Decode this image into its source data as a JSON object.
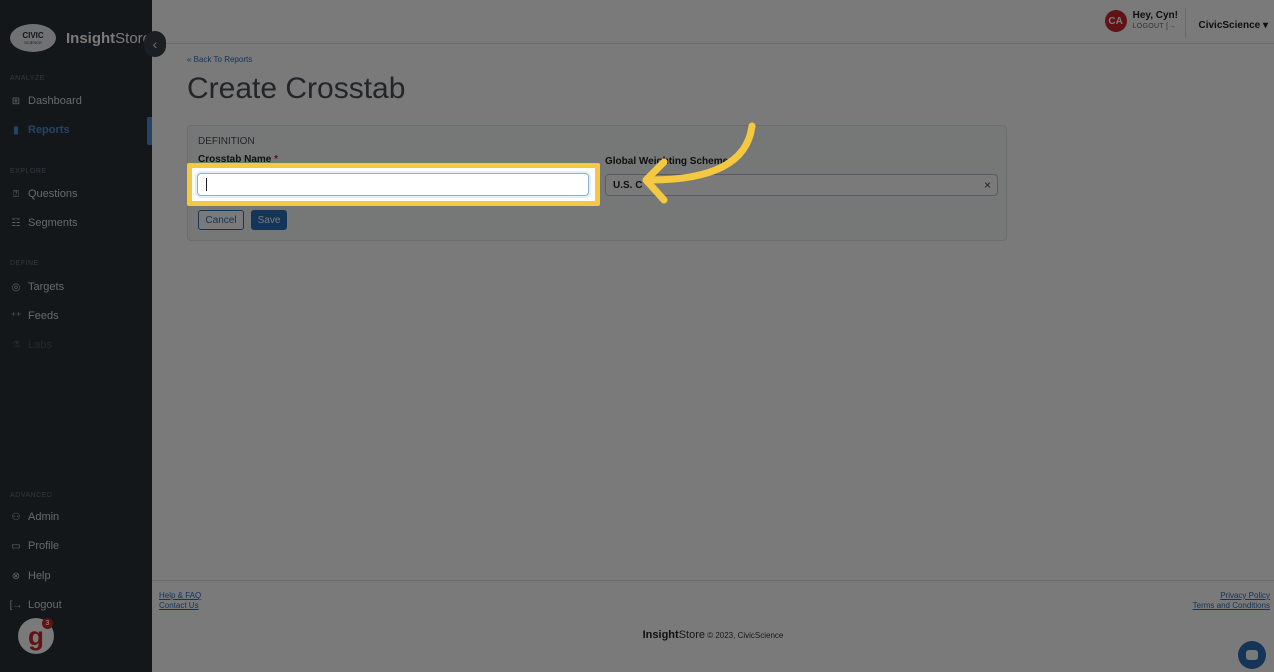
{
  "brand": {
    "logo_top": "CIVIC",
    "logo_bottom": "SCIENCE",
    "name_bold": "Insight",
    "name_rest": "Store"
  },
  "sidebar": {
    "sections": {
      "analyze": "ANALYZE",
      "explore": "EXPLORE",
      "define": "DEFINE",
      "advanced": "ADVANCED"
    },
    "items": {
      "dashboard": "Dashboard",
      "reports": "Reports",
      "questions": "Questions",
      "segments": "Segments",
      "targets": "Targets",
      "feeds": "Feeds",
      "labs": "Labs",
      "admin": "Admin",
      "profile": "Profile",
      "help": "Help",
      "logout": "Logout"
    },
    "collapse_glyph": "‹",
    "badge_letter": "g",
    "badge_sup": "3"
  },
  "topbar": {
    "avatar_initials": "CA",
    "greeting": "Hey, Cyn!",
    "logout_label": "LOGOUT [→",
    "org_menu": "CivicScience ▾"
  },
  "main": {
    "back_link": "« Back To Reports",
    "title": "Create Crosstab",
    "card_title": "DEFINITION",
    "crosstab_name_label": "Crosstab Name",
    "required_mark": "*",
    "crosstab_name_value": "",
    "weighting_label": "Global Weighting Scheme",
    "weighting_value": "U.S. C",
    "clear_glyph": "×",
    "cancel_label": "Cancel",
    "save_label": "Save"
  },
  "footer": {
    "help_faq": "Help & FAQ",
    "contact_us": "Contact Us",
    "privacy_policy": "Privacy Policy",
    "terms": "Terms and Conditions",
    "copyright_bold": "Insight",
    "copyright_store": "Store",
    "copyright_rest": "© 2023, CivicScience"
  },
  "colors": {
    "highlight": "#f5c842",
    "accent": "#2d6fb8",
    "brand_red": "#c8262b",
    "sidebar_bg": "#2b3038"
  }
}
